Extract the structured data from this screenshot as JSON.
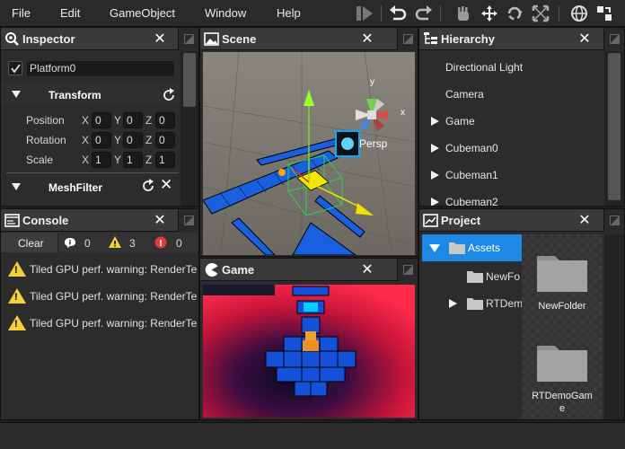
{
  "menu": {
    "file": "File",
    "edit": "Edit",
    "gameobject": "GameObject",
    "window": "Window",
    "help": "Help"
  },
  "inspector": {
    "title": "Inspector",
    "object_name": "Platform0",
    "transform_label": "Transform",
    "position_label": "Position",
    "rotation_label": "Rotation",
    "scale_label": "Scale",
    "position": {
      "x": "0",
      "y": "0",
      "z": "0"
    },
    "rotation": {
      "x": "0",
      "y": "0",
      "z": "0"
    },
    "scale": {
      "x": "1",
      "y": "1",
      "z": "1"
    },
    "meshfilter_label": "MeshFilter",
    "axis_x": "X",
    "axis_y": "Y",
    "axis_z": "Z"
  },
  "scene": {
    "title": "Scene",
    "persp_label": "Persp",
    "gizmo_x": "x",
    "gizmo_y": "y"
  },
  "hierarchy": {
    "title": "Hierarchy",
    "items": [
      {
        "label": "Directional Light",
        "expandable": false
      },
      {
        "label": "Camera",
        "expandable": false
      },
      {
        "label": "Game",
        "expandable": true
      },
      {
        "label": "Cubeman0",
        "expandable": true
      },
      {
        "label": "Cubeman1",
        "expandable": true
      },
      {
        "label": "Cubeman2",
        "expandable": true
      }
    ]
  },
  "console": {
    "title": "Console",
    "clear_label": "Clear",
    "info_count": "0",
    "warning_count": "3",
    "error_count": "0",
    "messages": [
      "Tiled GPU perf. warning: RenderTe",
      "Tiled GPU perf. warning: RenderTe",
      "Tiled GPU perf. warning: RenderTe"
    ]
  },
  "game": {
    "title": "Game"
  },
  "project": {
    "title": "Project",
    "tree": {
      "assets": "Assets",
      "newfolder": "NewFo",
      "rtdemo": "RTDem"
    },
    "grid": {
      "item1": "NewFolder",
      "item2_line1": "RTDemoGam",
      "item2_line2": "e"
    }
  },
  "colors": {
    "accent_blue": "#1e88e5",
    "warning_yellow": "#f4d03f",
    "error_red": "#e53935"
  }
}
